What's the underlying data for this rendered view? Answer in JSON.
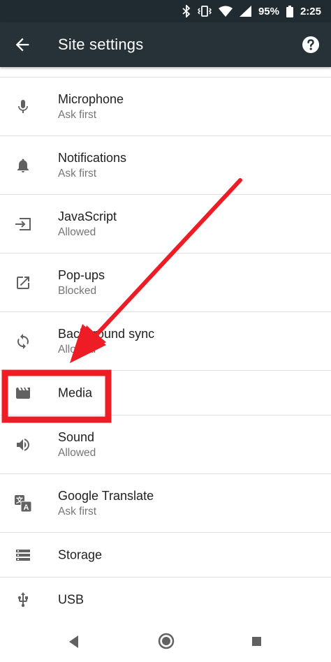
{
  "status_bar": {
    "battery": "95%",
    "time": "2:25"
  },
  "app_bar": {
    "title": "Site settings"
  },
  "items": [
    {
      "title": "Microphone",
      "subtitle": "Ask first",
      "icon": "microphone-icon"
    },
    {
      "title": "Notifications",
      "subtitle": "Ask first",
      "icon": "bell-icon"
    },
    {
      "title": "JavaScript",
      "subtitle": "Allowed",
      "icon": "javascript-icon"
    },
    {
      "title": "Pop-ups",
      "subtitle": "Blocked",
      "icon": "popup-icon"
    },
    {
      "title": "Background sync",
      "subtitle": "Allowed",
      "icon": "sync-icon"
    },
    {
      "title": "Media",
      "icon": "media-clapperboard-icon"
    },
    {
      "title": "Sound",
      "subtitle": "Allowed",
      "icon": "speaker-icon"
    },
    {
      "title": "Google Translate",
      "subtitle": "Ask first",
      "icon": "translate-icon"
    },
    {
      "title": "Storage",
      "icon": "storage-icon"
    },
    {
      "title": "USB",
      "icon": "usb-icon"
    }
  ],
  "annotation": {
    "highlight_color": "#ee1c25",
    "arrow_color": "#ee1c25"
  },
  "colors": {
    "app_bar": "#263238",
    "status_bar": "#1f2b31",
    "icon": "#616161"
  }
}
